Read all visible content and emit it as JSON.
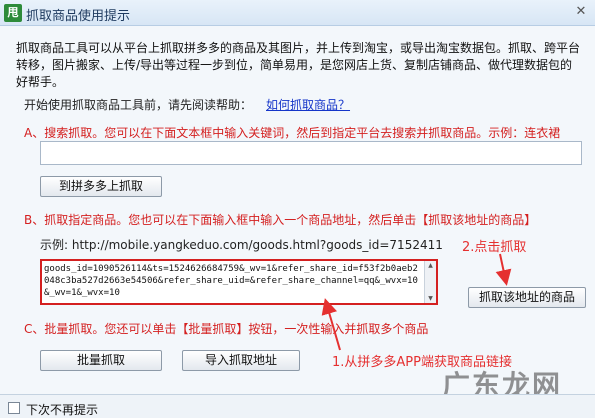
{
  "window": {
    "title": "抓取商品使用提示",
    "close_glyph": "✕",
    "app_icon_text": "甩"
  },
  "intro": "抓取商品工具可以从平台上抓取拼多多的商品及其图片，并上传到淘宝，或导出淘宝数据包。抓取、跨平台转移，图片搬家、上传/导出等过程一步到位，简单易用，是您网店上货、复制店铺商品、做代理数据包的好帮手。",
  "help": {
    "prompt": "开始使用抓取商品工具前，请先阅读帮助：",
    "link": "如何抓取商品？"
  },
  "section_a": {
    "heading": "A、搜索抓取。您可以在下面文本框中输入关键词，然后到指定平台去搜索并抓取商品。示例：连衣裙",
    "input_value": "",
    "button": "到拼多多上抓取"
  },
  "section_b": {
    "heading": "B、抓取指定商品。您也可以在下面输入框中输入一个商品地址，然后单击【抓取该地址的商品】",
    "example": "示例: http://mobile.yangkeduo.com/goods.html?goods_id=7152411",
    "url_value": "goods_id=1090526114&ts=1524626684759&_wv=1&refer_share_id=f53f2b0aeb2048c3ba527d2663e54506&refer_share_uid=&refer_share_channel=qq&_wvx=10&_wv=1&_wvx=10",
    "button": "抓取该地址的商品"
  },
  "section_c": {
    "heading": "C、批量抓取。您还可以单击【批量抓取】按钮，一次性输入并抓取多个商品",
    "button_batch": "批量抓取",
    "button_import": "导入抓取地址"
  },
  "annotations": {
    "step1": "1.从拼多多APP端获取商品链接",
    "step2": "2.点击抓取",
    "color": "#e53030"
  },
  "footer": {
    "checkbox_label": "下次不再提示",
    "checked": false
  },
  "watermark": "广东龙网",
  "colors": {
    "accent_red": "#d42020",
    "link_blue": "#1535c9",
    "background": "#f3f7fb"
  }
}
